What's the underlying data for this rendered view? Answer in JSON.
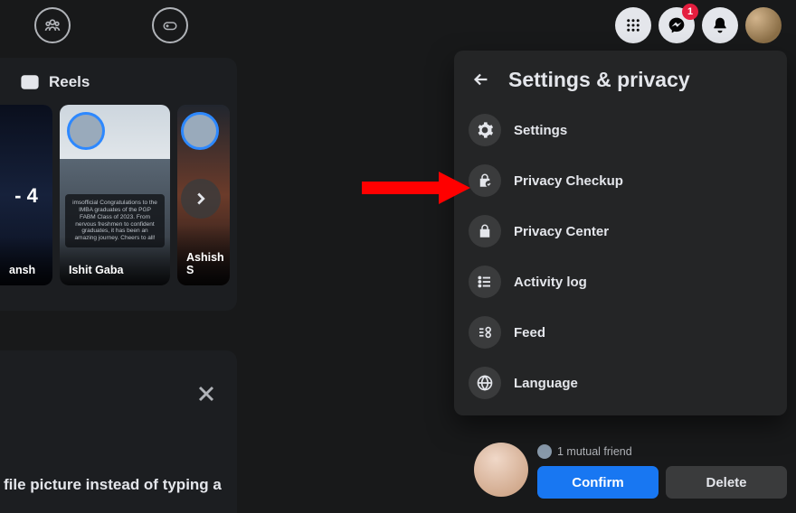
{
  "topbar": {
    "notifications_badge": "1"
  },
  "reels": {
    "title": "Reels",
    "cards": [
      {
        "score": "- 4",
        "caption": "ansh"
      },
      {
        "caption": "Ishit Gaba",
        "mini_text": "imsofficial Congratulations to the IMBA graduates of the PGP FABM Class of 2023.\nFrom nervous freshmen to confident graduates, it has been an amazing journey. Cheers to all!"
      },
      {
        "caption": "Ashish S"
      }
    ]
  },
  "dropdown": {
    "title": "Settings & privacy",
    "items": [
      {
        "label": "Settings"
      },
      {
        "label": "Privacy Checkup"
      },
      {
        "label": "Privacy Center"
      },
      {
        "label": "Activity log"
      },
      {
        "label": "Feed"
      },
      {
        "label": "Language"
      }
    ]
  },
  "friend_request": {
    "mutual": "1 mutual friend",
    "confirm": "Confirm",
    "delete": "Delete"
  },
  "cutoff_text": "file picture instead of typing a"
}
